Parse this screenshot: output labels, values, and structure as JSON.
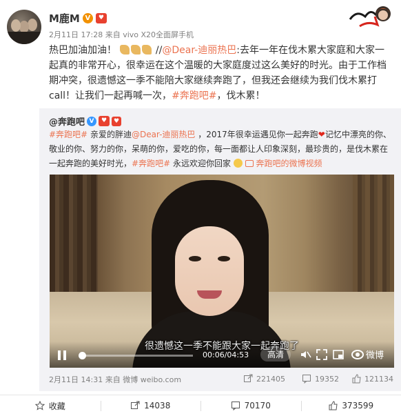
{
  "post": {
    "author": "M鹿M",
    "verified_badge": "V",
    "fan_badge": "♥",
    "date": "2月11日 17:28",
    "source_prefix": "来自",
    "source": "vivo X20全面屏手机",
    "text_lead": "热巴加油加油！",
    "text_slashes": "//",
    "mention": "@Dear-迪丽热巴",
    "text_mid": ":去年一年在伐木累大家庭和大家一起真的非常开心，很幸运在这个温暖的大家庭度过这么美好的时光。由于工作档期冲突，很遗憾这一季不能陪大家继续奔跑了，但我还会继续为我们伐木累打call！让我们一起再喊一次，",
    "hashtag": "#奔跑吧#",
    "text_tail": "，伐木累！",
    "emoji_count": 3
  },
  "repost": {
    "author": "@奔跑吧",
    "verified_badge": "V",
    "fan_badge": "♥",
    "red_badge": "♥",
    "hashtag1": "#奔跑吧#",
    "text1": " 亲爱的胖迪",
    "mention": "@Dear-迪丽热巴",
    "text2": " ，2017年很幸运遇见你一起奔跑",
    "heart": "❤",
    "text3": "记忆中漂亮的你、敬业的你、努力的你，呆萌的你，爱吃的你，每一面都让人印象深刻，最珍贵的，是伐木累在一起奔跑的美好时光，",
    "hashtag2": "#奔跑吧#",
    "text4": " 永远欢迎你回家",
    "video_link": "奔跑吧的微博视频",
    "video": {
      "subtitle": "很遗憾这一季不能跟大家一起奔跑了",
      "current_time": "00:06",
      "total_time": "04:53",
      "time_display": "00:06/04:53",
      "progress": 0.02,
      "quality": "高清",
      "weibo_brand": "微博"
    },
    "date": "2月11日 14:31",
    "source_prefix": "来自",
    "source": "微博 weibo.com",
    "shares": "221405",
    "comments": "19352",
    "likes": "121134"
  },
  "actions": {
    "favorite": "收藏",
    "repost_count": "14038",
    "comment_count": "70170",
    "like_count": "373599"
  },
  "colors": {
    "link": "#eb7350",
    "meta": "#808080",
    "repost_bg": "#f2f2f5",
    "verified_orange": "#f29100",
    "verified_blue": "#3597ff"
  }
}
